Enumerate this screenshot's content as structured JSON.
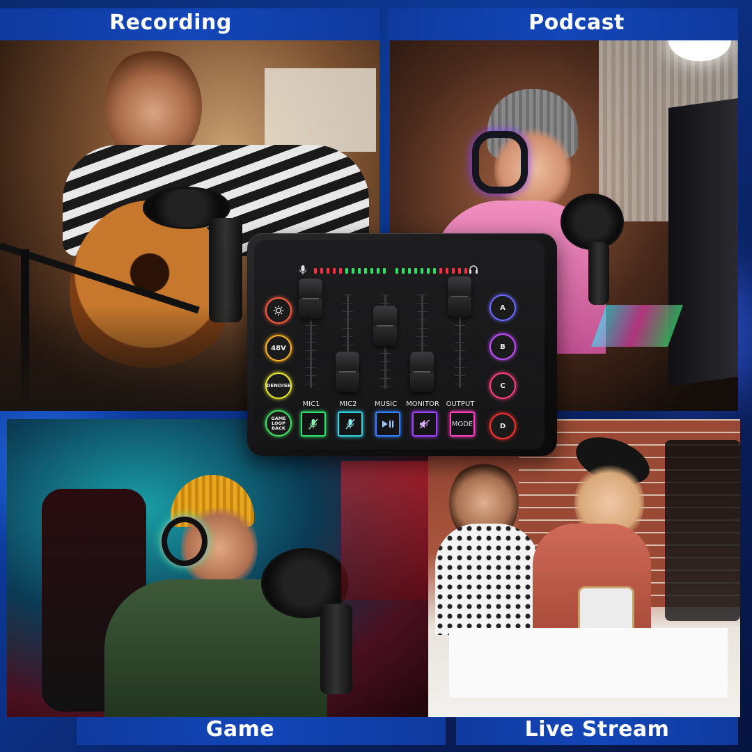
{
  "labels": {
    "recording": "Recording",
    "podcast": "Podcast",
    "game": "Game",
    "live_stream": "Live Stream"
  },
  "mixer": {
    "left_buttons": [
      {
        "label": "",
        "icon": "brightness-icon",
        "color": "#ff5a3c"
      },
      {
        "label": "48V",
        "color": "#ffb020"
      },
      {
        "label": "DENOISE",
        "color": "#e8e830"
      },
      {
        "label": "GAME LOOP BACK",
        "color": "#40e060"
      }
    ],
    "right_buttons": [
      {
        "label": "A",
        "color": "#6a6aff"
      },
      {
        "label": "B",
        "color": "#c050ff"
      },
      {
        "label": "C",
        "color": "#ff4080"
      },
      {
        "label": "D",
        "color": "#ff3030"
      }
    ],
    "channels": [
      {
        "label": "MIC1",
        "icon": "mic-mute-icon",
        "color": "#30e070",
        "level": 0.95
      },
      {
        "label": "MIC2",
        "icon": "mic-mute-icon",
        "color": "#30d0e0",
        "level": 0.2
      },
      {
        "label": "MUSIC",
        "icon": "play-pause-icon",
        "color": "#3080ff",
        "level": 0.7
      },
      {
        "label": "MONITOR",
        "icon": "speaker-mute-icon",
        "color": "#a040ff",
        "level": 0.2
      },
      {
        "label": "OUTPUT",
        "text": "MODE",
        "color": "#ff40c0",
        "level": 0.95
      }
    ],
    "meter_icons": [
      "mic-icon",
      "headphones-icon"
    ]
  }
}
